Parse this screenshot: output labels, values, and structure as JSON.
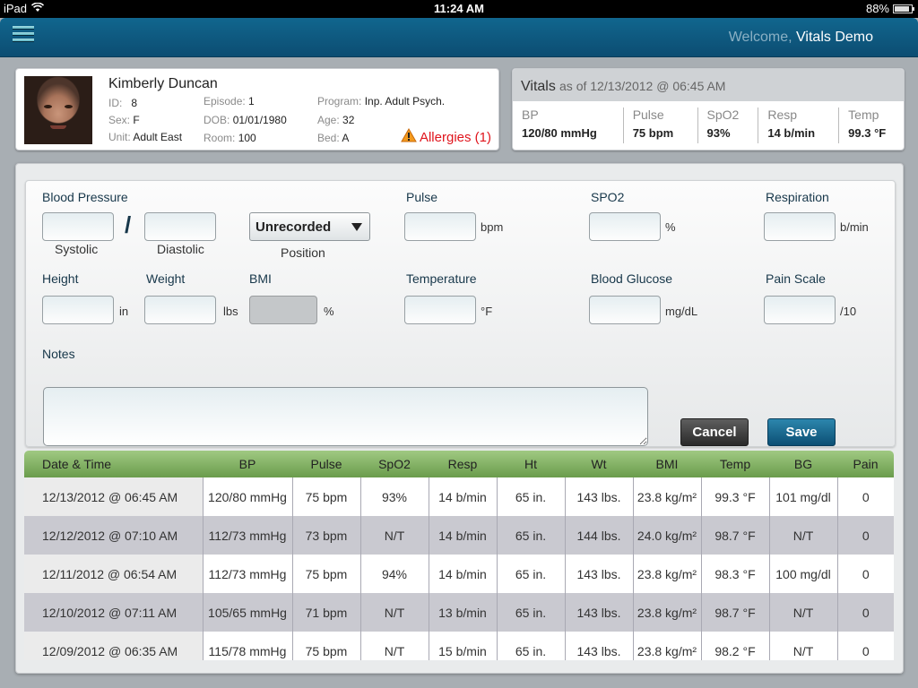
{
  "status_bar": {
    "device": "iPad",
    "time": "11:24 AM",
    "battery": "88%",
    "battery_level": 0.88
  },
  "header": {
    "welcome_label": "Welcome,",
    "user_name": "Vitals Demo"
  },
  "patient": {
    "name": "Kimberly Duncan",
    "fields": [
      {
        "label": "ID:",
        "value": "8"
      },
      {
        "label": "Sex:",
        "value": "F"
      },
      {
        "label": "Unit:",
        "value": "Adult East"
      },
      {
        "label": "Episode:",
        "value": "1"
      },
      {
        "label": "DOB:",
        "value": "01/01/1980"
      },
      {
        "label": "Room:",
        "value": "100"
      },
      {
        "label": "Program:",
        "value": "Inp. Adult Psych."
      },
      {
        "label": "Age:",
        "value": "32"
      },
      {
        "label": "Bed:",
        "value": "A"
      }
    ],
    "allergies_label": "Allergies (1)"
  },
  "vitals_summary": {
    "title": "Vitals",
    "as_of": "as of 12/13/2012 @ 06:45 AM",
    "items": [
      {
        "label": "BP",
        "value": "120/80 mmHg"
      },
      {
        "label": "Pulse",
        "value": "75 bpm"
      },
      {
        "label": "SpO2",
        "value": "93%"
      },
      {
        "label": "Resp",
        "value": "14 b/min"
      },
      {
        "label": "Temp",
        "value": "99.3 °F"
      }
    ]
  },
  "form": {
    "blood_pressure": {
      "label": "Blood Pressure",
      "systolic_label": "Systolic",
      "diastolic_label": "Diastolic",
      "separator": "/",
      "systolic_value": "",
      "diastolic_value": ""
    },
    "position": {
      "selected": "Unrecorded",
      "label": "Position"
    },
    "pulse": {
      "label": "Pulse",
      "unit": "bpm",
      "value": ""
    },
    "spo2": {
      "label": "SPO2",
      "unit": "%",
      "value": ""
    },
    "respiration": {
      "label": "Respiration",
      "unit": "b/min",
      "value": ""
    },
    "height": {
      "label": "Height",
      "unit": "in",
      "value": ""
    },
    "weight": {
      "label": "Weight",
      "unit": "lbs",
      "value": ""
    },
    "bmi": {
      "label": "BMI",
      "unit": "%",
      "value": ""
    },
    "temperature": {
      "label": "Temperature",
      "unit": "°F",
      "value": ""
    },
    "blood_glucose": {
      "label": "Blood Glucose",
      "unit": "mg/dL",
      "value": ""
    },
    "pain_scale": {
      "label": "Pain Scale",
      "unit": "/10",
      "value": ""
    },
    "notes": {
      "label": "Notes",
      "value": ""
    },
    "cancel_label": "Cancel",
    "save_label": "Save"
  },
  "history": {
    "columns": [
      "Date & Time",
      "BP",
      "Pulse",
      "SpO2",
      "Resp",
      "Ht",
      "Wt",
      "BMI",
      "Temp",
      "BG",
      "Pain"
    ],
    "rows": [
      [
        "12/13/2012 @ 06:45 AM",
        "120/80 mmHg",
        "75 bpm",
        "93%",
        "14 b/min",
        "65 in.",
        "143 lbs.",
        "23.8 kg/m²",
        "99.3 °F",
        "101 mg/dl",
        "0"
      ],
      [
        "12/12/2012 @ 07:10 AM",
        "112/73 mmHg",
        "73 bpm",
        "N/T",
        "14 b/min",
        "65 in.",
        "144 lbs.",
        "24.0 kg/m²",
        "98.7 °F",
        "N/T",
        "0"
      ],
      [
        "12/11/2012 @ 06:54 AM",
        "112/73 mmHg",
        "75 bpm",
        "94%",
        "14 b/min",
        "65 in.",
        "143 lbs.",
        "23.8 kg/m²",
        "98.3 °F",
        "100 mg/dl",
        "0"
      ],
      [
        "12/10/2012 @ 07:11 AM",
        "105/65 mmHg",
        "71 bpm",
        "N/T",
        "13 b/min",
        "65 in.",
        "143 lbs.",
        "23.8 kg/m²",
        "98.7 °F",
        "N/T",
        "0"
      ],
      [
        "12/09/2012 @ 06:35 AM",
        "115/78 mmHg",
        "75 bpm",
        "N/T",
        "15 b/min",
        "65 in.",
        "143 lbs.",
        "23.8 kg/m²",
        "98.2 °F",
        "N/T",
        "0"
      ]
    ]
  },
  "colors": {
    "header_blue": "#0c4d72",
    "table_header_green": "#6a9c4c",
    "allergy_red": "#e0141c",
    "save_blue": "#0c4f74"
  }
}
